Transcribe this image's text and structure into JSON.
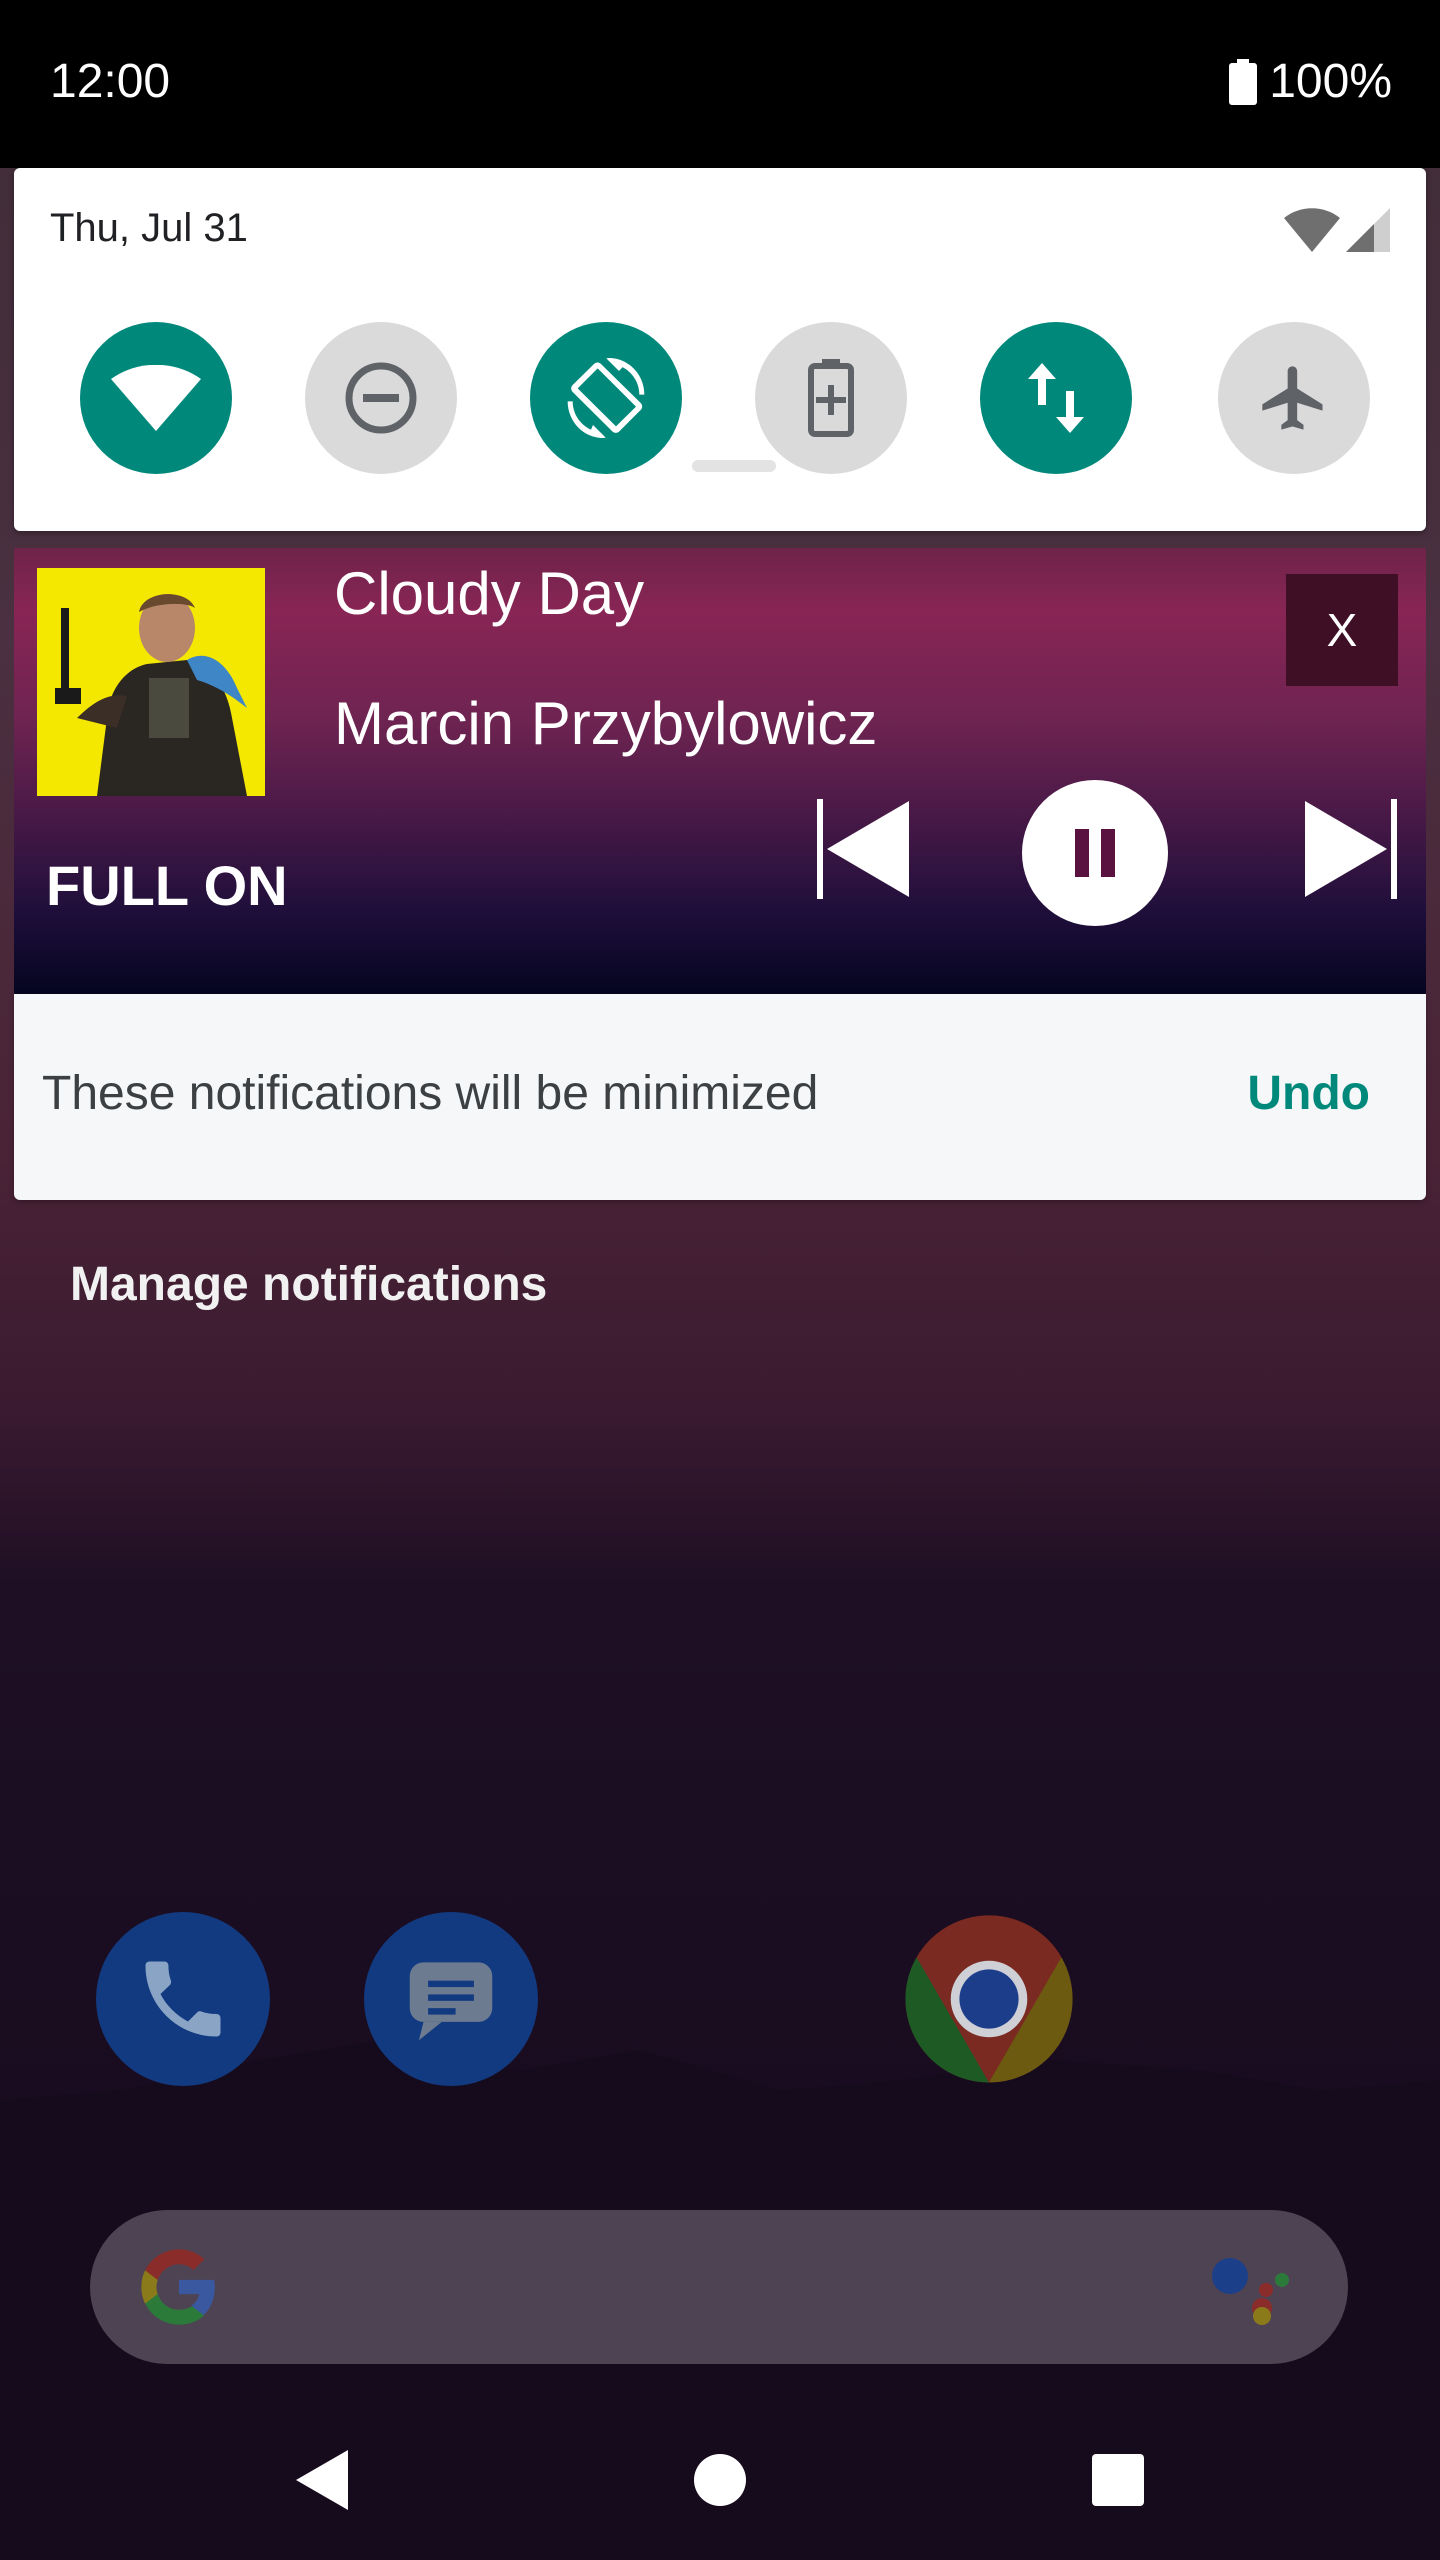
{
  "status_bar": {
    "time": "12:00",
    "battery_percent": "100%",
    "icons": [
      "battery-full-icon"
    ]
  },
  "quick_settings": {
    "date": "Thu, Jul 31",
    "status_icons": [
      "wifi-signal-icon",
      "cell-signal-icon"
    ],
    "tiles": [
      {
        "name": "wifi",
        "icon": "wifi-icon",
        "active": true
      },
      {
        "name": "do-not-disturb",
        "icon": "do-not-disturb-icon",
        "active": false
      },
      {
        "name": "auto-rotate",
        "icon": "auto-rotate-icon",
        "active": true
      },
      {
        "name": "battery-saver",
        "icon": "battery-saver-icon",
        "active": false
      },
      {
        "name": "mobile-data",
        "icon": "mobile-data-icon",
        "active": true
      },
      {
        "name": "airplane-mode",
        "icon": "airplane-icon",
        "active": false
      }
    ],
    "accent_color": "#00897b"
  },
  "media_notification": {
    "title": "Cloudy Day",
    "artist": "Marcin Przybylowicz",
    "app_label": "FULL ON",
    "close_label": "X",
    "controls": [
      "previous-icon",
      "pause-icon",
      "next-icon"
    ],
    "album_art_colors": {
      "background": "#f5e800"
    }
  },
  "minimized_notice": {
    "text": "These notifications will be minimized",
    "action": "Undo"
  },
  "manage_notifications": "Manage notifications",
  "home_screen": {
    "dock_apps": [
      "phone-icon",
      "messages-icon",
      "chrome-icon"
    ],
    "search_logo": "google-g-icon",
    "assistant": "google-assistant-icon"
  },
  "nav_bar": {
    "buttons": [
      "back-icon",
      "home-icon",
      "recents-icon"
    ]
  }
}
